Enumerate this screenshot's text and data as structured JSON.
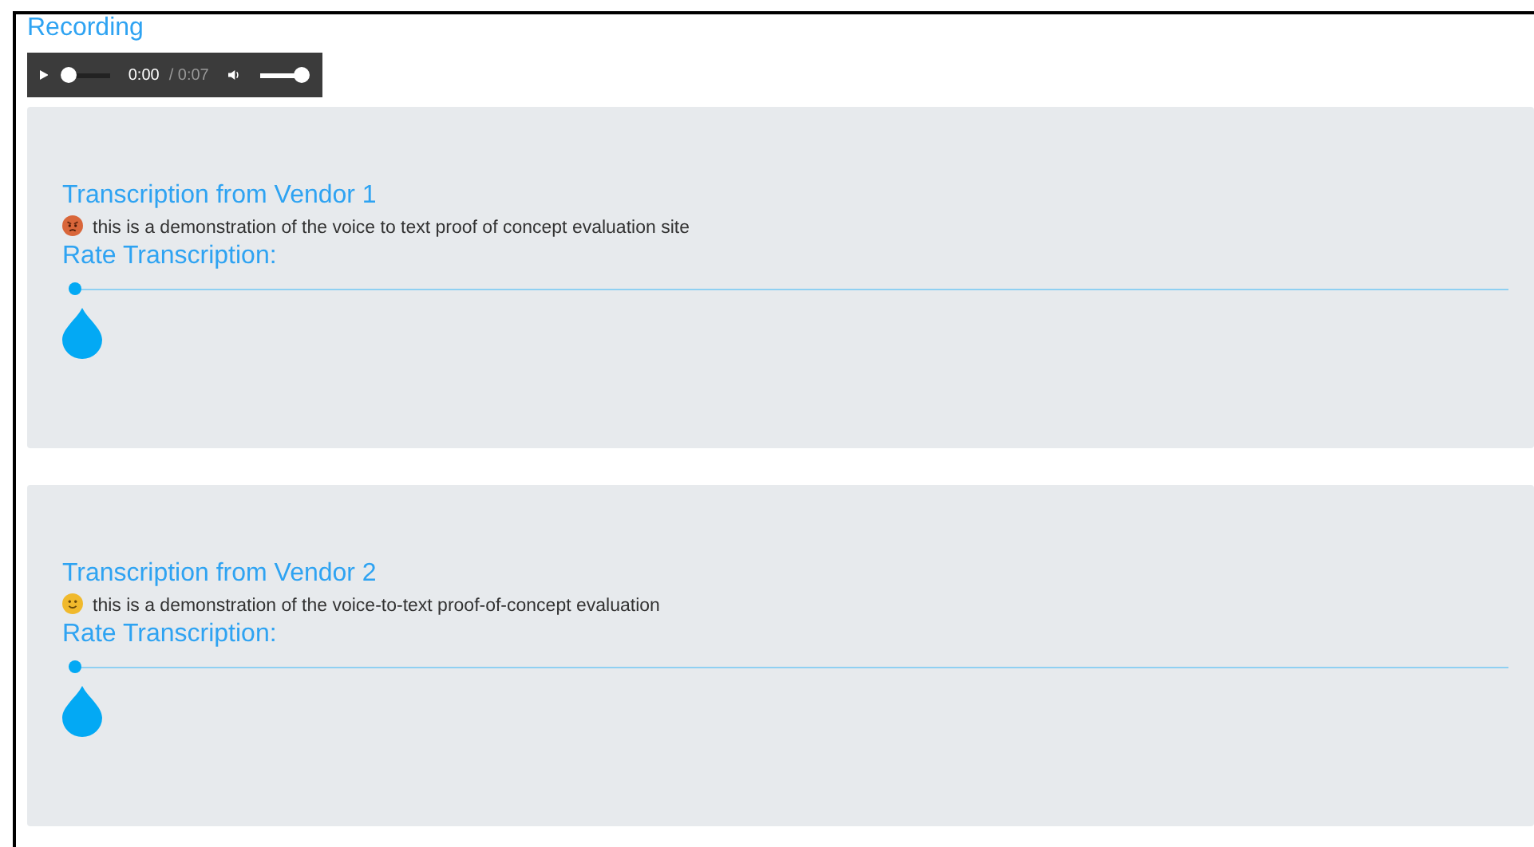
{
  "title": "Recording",
  "player": {
    "current_time": "0:00",
    "duration": "/ 0:07",
    "progress": {
      "level": 0
    },
    "volume": {
      "level": 1
    }
  },
  "transcriptions": [
    {
      "title": "Transcription from Vendor 1",
      "kind": "angry",
      "text": "this is a demonstration of the voice to text proof of concept evaluation site",
      "rating_label": "Rate Transcription:",
      "rating": {
        "level": 0
      }
    },
    {
      "title": "Transcription from Vendor 2",
      "kind": "smile",
      "text": "this is a demonstration of the voice-to-text proof-of-concept evaluation",
      "rating_label": "Rate Transcription:",
      "rating": {
        "level": 0
      }
    }
  ]
}
